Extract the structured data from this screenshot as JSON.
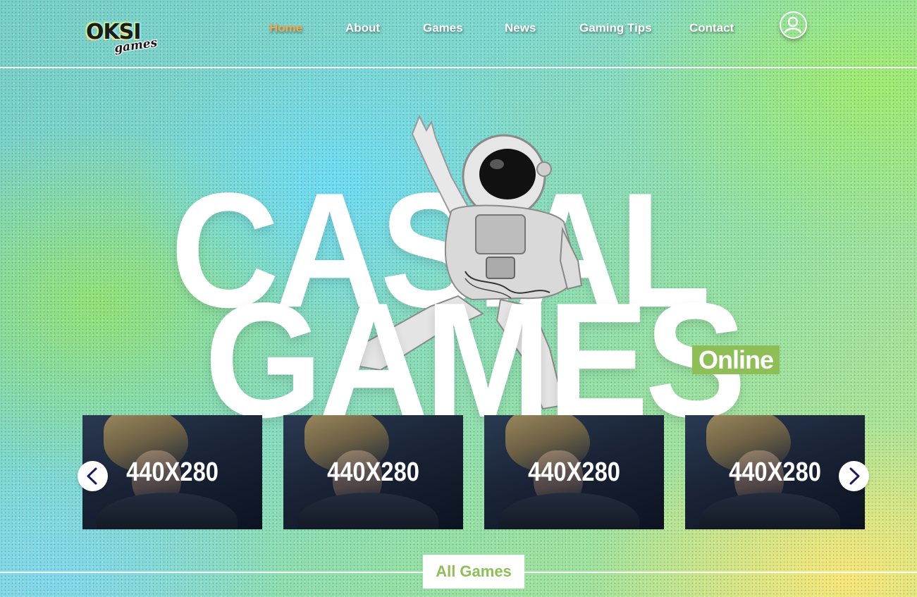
{
  "brand": {
    "logo_main": "OKSI",
    "logo_sub": "games"
  },
  "nav": {
    "items": [
      {
        "label": "Home",
        "active": true
      },
      {
        "label": "About",
        "active": false
      },
      {
        "label": "Games",
        "active": false
      },
      {
        "label": "News",
        "active": false
      },
      {
        "label": "Gaming Tips",
        "active": false
      },
      {
        "label": "Contact",
        "active": false
      }
    ],
    "user_icon": "user-circle-icon"
  },
  "hero": {
    "title_line1": "CASIAL",
    "title_line2": "GAMES",
    "badge": "Online",
    "image": "astronaut-image"
  },
  "carousel": {
    "cards": [
      {
        "label": "440X280"
      },
      {
        "label": "440X280"
      },
      {
        "label": "440X280"
      },
      {
        "label": "440X280"
      }
    ],
    "prev_icon": "chevron-left-icon",
    "next_icon": "chevron-right-icon"
  },
  "footer": {
    "all_games_label": "All Games"
  },
  "colors": {
    "accent_green": "#8ebf57",
    "active_nav": "#f3a64a",
    "arrow_navy": "#1d1a5c"
  }
}
